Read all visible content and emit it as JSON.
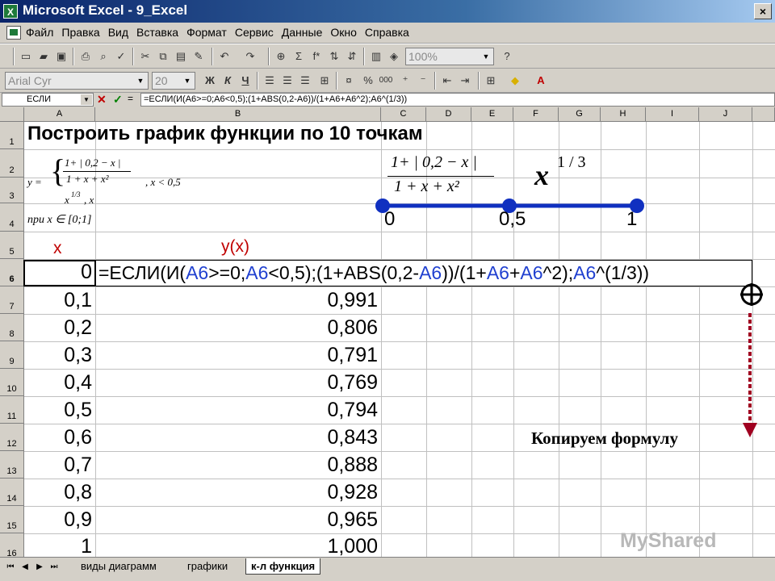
{
  "window": {
    "title": "Microsoft Excel - 9_Excel",
    "app_icon": "X",
    "close_symbol": "×"
  },
  "menu": [
    "Файл",
    "Правка",
    "Вид",
    "Вставка",
    "Формат",
    "Сервис",
    "Данные",
    "Окно",
    "Справка"
  ],
  "toolbar": {
    "zoom": "100%",
    "font_name": "Arial Cyr",
    "font_size": "20",
    "bold": "Ж",
    "italic": "К",
    "underline": "Ч",
    "percent": "%",
    "thousands": "000",
    "sum": "Σ",
    "fx": "f*",
    "help": "?"
  },
  "formula_bar": {
    "name_box": "ЕСЛИ",
    "cancel": "✕",
    "enter": "✓",
    "equals": "=",
    "content": "=ЕСЛИ(И(A6>=0;A6<0,5);(1+ABS(0,2-A6))/(1+A6+A6^2);A6^(1/3))"
  },
  "columns": [
    "A",
    "B",
    "C",
    "D",
    "E",
    "F",
    "G",
    "H",
    "I",
    "J"
  ],
  "rows": [
    "1",
    "2",
    "3",
    "4",
    "5",
    "6",
    "7",
    "8",
    "9",
    "10",
    "11",
    "12",
    "13",
    "14",
    "15",
    "16"
  ],
  "sheet": {
    "title": "Построить график функции  по 10 точкам",
    "header_x": "x",
    "header_y": "y(x)",
    "x_values": [
      "0",
      "0,1",
      "0,2",
      "0,3",
      "0,4",
      "0,5",
      "0,6",
      "0,7",
      "0,8",
      "0,9",
      "1"
    ],
    "y_values": [
      "0,991",
      "0,806",
      "0,791",
      "0,769",
      "0,794",
      "0,843",
      "0,888",
      "0,928",
      "0,965",
      "1,000"
    ],
    "formula_in_cell": {
      "p1": "=ЕСЛИ(И(",
      "r1": "A6",
      "p2": ">=0;",
      "r2": "A6",
      "p3": "<0,5);(1+ABS(0,2-",
      "r3": "A6",
      "p4": "))/(1+",
      "r4": "A6",
      "p5": "+",
      "r5": "A6",
      "p6": "^2);",
      "r6": "A6",
      "p7": "^(1/3))"
    }
  },
  "math": {
    "system_y": "y =",
    "case1_num": "1+ | 0,2 − x |",
    "case1_den": "1 + x + x²",
    "case1_cond": ", x < 0,5",
    "case2": "x",
    "case2_exp": "1/3",
    "case2_cond": ",     x",
    "domain": "при x ∈ [0;1]",
    "big_num": "1+ | 0,2 − x |",
    "big_den": "1 + x + x²",
    "big_x": "x",
    "big_exp": "1 / 3",
    "axis_labels": [
      "0",
      "0,5",
      "1"
    ]
  },
  "annotation": "Копируем формулу",
  "sheet_tabs": [
    "виды диаграмм",
    "графики",
    "к-л функция"
  ],
  "watermark": "MyShared",
  "colors": {
    "red_header": "#c00000",
    "line_blue": "#1030c0",
    "arrow_red": "#a00020",
    "ref_blue": "#2040d0"
  }
}
